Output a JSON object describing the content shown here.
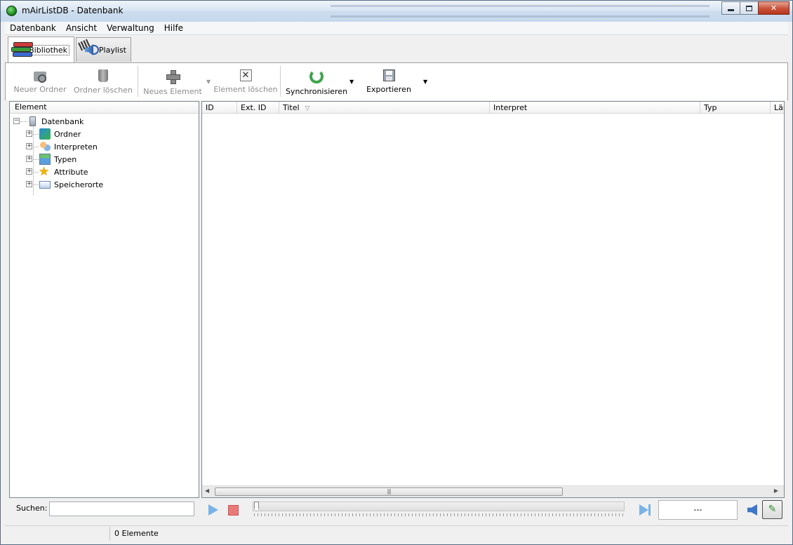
{
  "window": {
    "title": "mAirListDB - Datenbank"
  },
  "menu": [
    "Datenbank",
    "Ansicht",
    "Verwaltung",
    "Hilfe"
  ],
  "tabs": [
    {
      "label": "Bibliothek",
      "icon": "books-icon",
      "active": true
    },
    {
      "label": "Playlist",
      "icon": "speaker-icon",
      "active": false
    }
  ],
  "toolbar": {
    "new_folder": "Neuer Ordner",
    "delete_folder": "Ordner löschen",
    "new_element": "Neues Element",
    "delete_element": "Element löschen",
    "sync": "Synchronisieren",
    "export": "Exportieren"
  },
  "tree": {
    "header": "Element",
    "root": "Datenbank",
    "children": [
      "Ordner",
      "Interpreten",
      "Typen",
      "Attribute",
      "Speicherorte"
    ]
  },
  "columns": [
    "ID",
    "Ext. ID",
    "Titel",
    "Interpret",
    "Typ",
    "Län"
  ],
  "search": {
    "label": "Suchen:",
    "value": ""
  },
  "player": {
    "time": "---"
  },
  "status": {
    "count": "0 Elemente"
  },
  "colors": {
    "accent": "#7ab3e6",
    "stop": "#e97a7a",
    "sync": "#3fa34d"
  }
}
